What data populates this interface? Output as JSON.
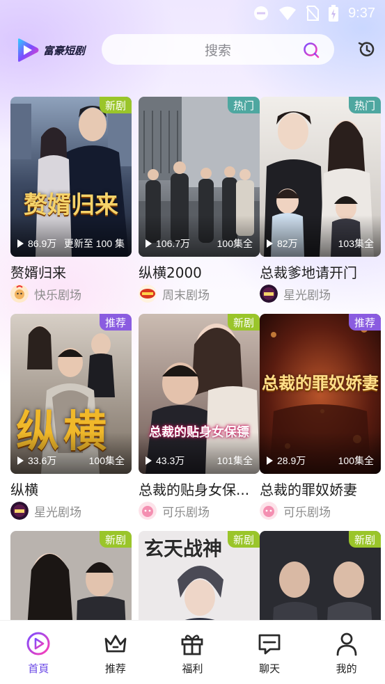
{
  "status_bar": {
    "time": "9:37"
  },
  "header": {
    "logo_text": "富豪短剧",
    "search_placeholder": "搜索"
  },
  "cards": [
    {
      "title": "赘婿归来",
      "badge": "新剧",
      "views": "86.9万",
      "episodes": "更新至 100 集",
      "source": "快乐剧场",
      "poster_title": "赘婿归来"
    },
    {
      "title": "纵横2000",
      "badge": "热门",
      "views": "106.7万",
      "episodes": "100集全",
      "source": "周末剧场",
      "poster_title": ""
    },
    {
      "title": "总裁爹地请开门",
      "badge": "热门",
      "views": "82万",
      "episodes": "103集全",
      "source": "星光剧场",
      "poster_title": ""
    },
    {
      "title": "纵横",
      "badge": "推荐",
      "views": "33.6万",
      "episodes": "100集全",
      "source": "星光剧场",
      "poster_title": "纵横"
    },
    {
      "title": "总裁的贴身女保...",
      "badge": "新剧",
      "views": "43.3万",
      "episodes": "101集全",
      "source": "可乐剧场",
      "poster_title": "总裁的贴身女保镖"
    },
    {
      "title": "总裁的罪奴娇妻",
      "badge": "推荐",
      "views": "28.9万",
      "episodes": "100集全",
      "source": "可乐剧场",
      "poster_title": "总裁的罪奴娇妻"
    },
    {
      "title": "",
      "badge": "新剧",
      "views": "",
      "episodes": "",
      "source": "",
      "poster_title": ""
    },
    {
      "title": "",
      "badge": "新剧",
      "views": "",
      "episodes": "",
      "source": "",
      "poster_title": "玄天战神"
    },
    {
      "title": "",
      "badge": "新剧",
      "views": "",
      "episodes": "",
      "source": "",
      "poster_title": ""
    }
  ],
  "tabbar": {
    "tabs": [
      {
        "label": "首頁",
        "icon": "home-play-icon",
        "active": true
      },
      {
        "label": "推荐",
        "icon": "crown-icon",
        "active": false
      },
      {
        "label": "福利",
        "icon": "gift-icon",
        "active": false
      },
      {
        "label": "聊天",
        "icon": "chat-icon",
        "active": false
      },
      {
        "label": "我的",
        "icon": "person-icon",
        "active": false
      }
    ]
  },
  "colors": {
    "accent": "#6b48e6",
    "badge_new": "#9ac52a",
    "badge_hot": "#4ea7a0",
    "badge_rec": "#8a5ce0"
  }
}
